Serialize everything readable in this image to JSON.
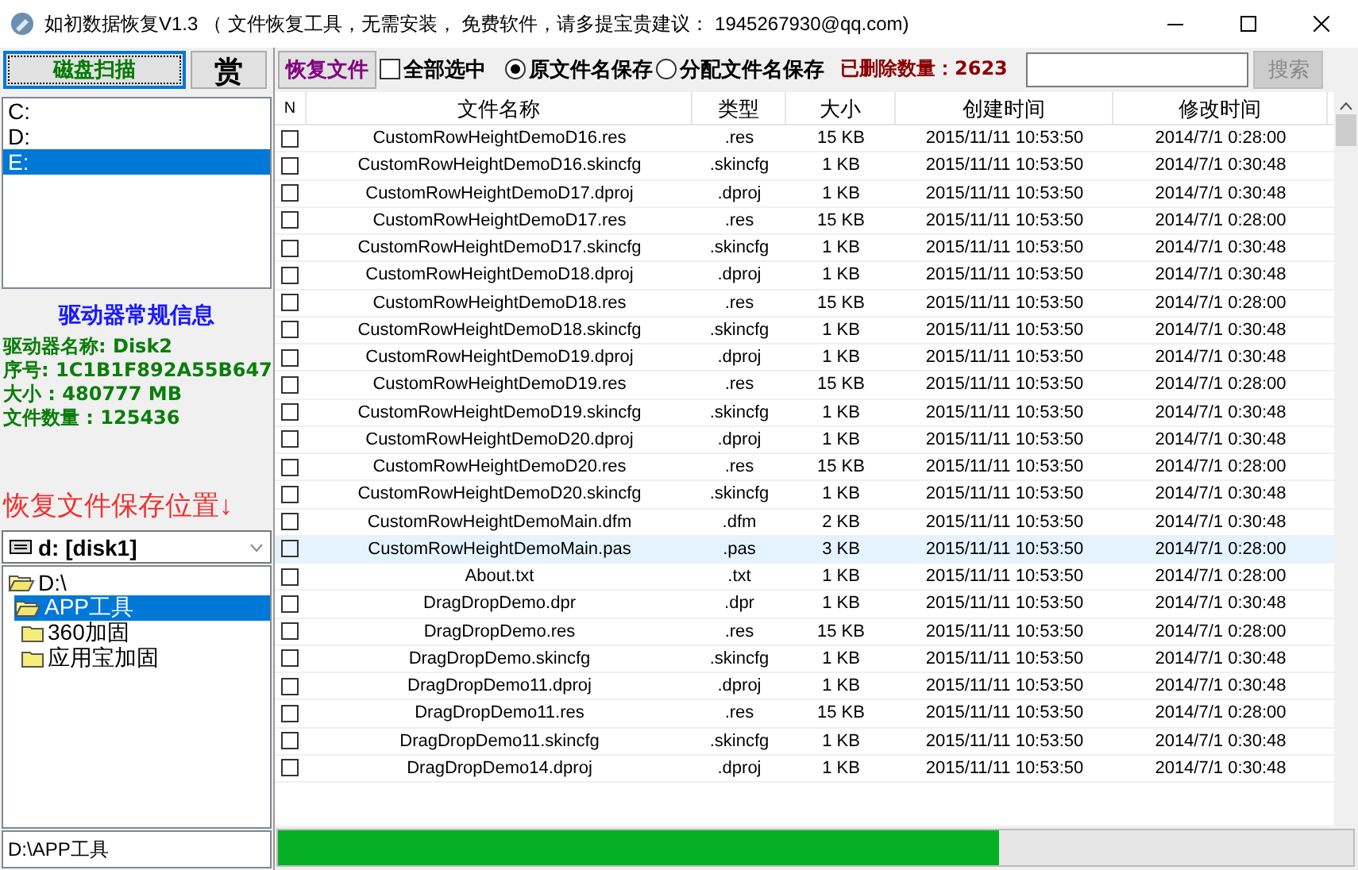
{
  "window": {
    "title": "如初数据恢复V1.3 （ 文件恢复工具，无需安装， 免费软件，请多提宝贵建议： 1945267930@qq.com)"
  },
  "toolbar": {
    "scan_button": "磁盘扫描",
    "reward_button": "赏",
    "recover_button": "恢复文件",
    "select_all": {
      "label": "全部选中",
      "checked": false
    },
    "name_options": [
      {
        "label": "原文件名保存",
        "selected": true
      },
      {
        "label": "分配文件名保存",
        "selected": false
      }
    ],
    "deleted_count": "已删除数量：2623",
    "search_button": {
      "label": "搜索",
      "disabled": true
    }
  },
  "drives": [
    {
      "label": "C:",
      "selected": false
    },
    {
      "label": "D:",
      "selected": false
    },
    {
      "label": "E:",
      "selected": true
    }
  ],
  "drive_info": {
    "title": "驱动器常规信息",
    "lines": [
      "驱动器名称: Disk2",
      "序号: 1C1B1F892A55B647",
      "大小 : 480777 MB",
      "文件数量 : 125436"
    ]
  },
  "save_location_label": "恢复文件保存位置↓",
  "target_drive": "d: [disk1]",
  "folder_tree": [
    {
      "label": "D:\\",
      "selected": false,
      "expanded": true,
      "children": [
        {
          "label": "APP工具",
          "selected": true,
          "expanded": true,
          "children": [
            {
              "label": "360加固",
              "selected": false,
              "expanded": false
            },
            {
              "label": "应用宝加固",
              "selected": false,
              "expanded": false
            }
          ]
        }
      ]
    }
  ],
  "current_path": "D:\\APP工具",
  "table": {
    "checkbox_header": "N",
    "columns": [
      "文件名称",
      "类型",
      "大小",
      "创建时间",
      "修改时间"
    ],
    "rows": [
      {
        "checked": false,
        "selected": false,
        "cells": [
          "CustomRowHeightDemoD16.res",
          ".res",
          "15 KB",
          "2015/11/11 10:53:50",
          "2014/7/1 0:28:00"
        ]
      },
      {
        "checked": false,
        "selected": false,
        "cells": [
          "CustomRowHeightDemoD16.skincfg",
          ".skincfg",
          "1 KB",
          "2015/11/11 10:53:50",
          "2014/7/1 0:30:48"
        ]
      },
      {
        "checked": false,
        "selected": false,
        "cells": [
          "CustomRowHeightDemoD17.dproj",
          ".dproj",
          "1 KB",
          "2015/11/11 10:53:50",
          "2014/7/1 0:30:48"
        ]
      },
      {
        "checked": false,
        "selected": false,
        "cells": [
          "CustomRowHeightDemoD17.res",
          ".res",
          "15 KB",
          "2015/11/11 10:53:50",
          "2014/7/1 0:28:00"
        ]
      },
      {
        "checked": false,
        "selected": false,
        "cells": [
          "CustomRowHeightDemoD17.skincfg",
          ".skincfg",
          "1 KB",
          "2015/11/11 10:53:50",
          "2014/7/1 0:30:48"
        ]
      },
      {
        "checked": false,
        "selected": false,
        "cells": [
          "CustomRowHeightDemoD18.dproj",
          ".dproj",
          "1 KB",
          "2015/11/11 10:53:50",
          "2014/7/1 0:30:48"
        ]
      },
      {
        "checked": false,
        "selected": false,
        "cells": [
          "CustomRowHeightDemoD18.res",
          ".res",
          "15 KB",
          "2015/11/11 10:53:50",
          "2014/7/1 0:28:00"
        ]
      },
      {
        "checked": false,
        "selected": false,
        "cells": [
          "CustomRowHeightDemoD18.skincfg",
          ".skincfg",
          "1 KB",
          "2015/11/11 10:53:50",
          "2014/7/1 0:30:48"
        ]
      },
      {
        "checked": false,
        "selected": false,
        "cells": [
          "CustomRowHeightDemoD19.dproj",
          ".dproj",
          "1 KB",
          "2015/11/11 10:53:50",
          "2014/7/1 0:30:48"
        ]
      },
      {
        "checked": false,
        "selected": false,
        "cells": [
          "CustomRowHeightDemoD19.res",
          ".res",
          "15 KB",
          "2015/11/11 10:53:50",
          "2014/7/1 0:28:00"
        ]
      },
      {
        "checked": false,
        "selected": false,
        "cells": [
          "CustomRowHeightDemoD19.skincfg",
          ".skincfg",
          "1 KB",
          "2015/11/11 10:53:50",
          "2014/7/1 0:30:48"
        ]
      },
      {
        "checked": false,
        "selected": false,
        "cells": [
          "CustomRowHeightDemoD20.dproj",
          ".dproj",
          "1 KB",
          "2015/11/11 10:53:50",
          "2014/7/1 0:30:48"
        ]
      },
      {
        "checked": false,
        "selected": false,
        "cells": [
          "CustomRowHeightDemoD20.res",
          ".res",
          "15 KB",
          "2015/11/11 10:53:50",
          "2014/7/1 0:28:00"
        ]
      },
      {
        "checked": false,
        "selected": false,
        "cells": [
          "CustomRowHeightDemoD20.skincfg",
          ".skincfg",
          "1 KB",
          "2015/11/11 10:53:50",
          "2014/7/1 0:30:48"
        ]
      },
      {
        "checked": false,
        "selected": false,
        "cells": [
          "CustomRowHeightDemoMain.dfm",
          ".dfm",
          "2 KB",
          "2015/11/11 10:53:50",
          "2014/7/1 0:30:48"
        ]
      },
      {
        "checked": false,
        "selected": true,
        "cells": [
          "CustomRowHeightDemoMain.pas",
          ".pas",
          "3 KB",
          "2015/11/11 10:53:50",
          "2014/7/1 0:28:00"
        ]
      },
      {
        "checked": false,
        "selected": false,
        "cells": [
          "About.txt",
          ".txt",
          "1 KB",
          "2015/11/11 10:53:50",
          "2014/7/1 0:28:00"
        ]
      },
      {
        "checked": false,
        "selected": false,
        "cells": [
          "DragDropDemo.dpr",
          ".dpr",
          "1 KB",
          "2015/11/11 10:53:50",
          "2014/7/1 0:30:48"
        ]
      },
      {
        "checked": false,
        "selected": false,
        "cells": [
          "DragDropDemo.res",
          ".res",
          "15 KB",
          "2015/11/11 10:53:50",
          "2014/7/1 0:28:00"
        ]
      },
      {
        "checked": false,
        "selected": false,
        "cells": [
          "DragDropDemo.skincfg",
          ".skincfg",
          "1 KB",
          "2015/11/11 10:53:50",
          "2014/7/1 0:30:48"
        ]
      },
      {
        "checked": false,
        "selected": false,
        "cells": [
          "DragDropDemo11.dproj",
          ".dproj",
          "1 KB",
          "2015/11/11 10:53:50",
          "2014/7/1 0:30:48"
        ]
      },
      {
        "checked": false,
        "selected": false,
        "cells": [
          "DragDropDemo11.res",
          ".res",
          "15 KB",
          "2015/11/11 10:53:50",
          "2014/7/1 0:28:00"
        ]
      },
      {
        "checked": false,
        "selected": false,
        "cells": [
          "DragDropDemo11.skincfg",
          ".skincfg",
          "1 KB",
          "2015/11/11 10:53:50",
          "2014/7/1 0:30:48"
        ]
      },
      {
        "checked": false,
        "selected": false,
        "cells": [
          "DragDropDemo14.dproj",
          ".dproj",
          "1 KB",
          "2015/11/11 10:53:50",
          "2014/7/1 0:30:48"
        ]
      }
    ]
  },
  "progress": {
    "level": 0.67
  }
}
